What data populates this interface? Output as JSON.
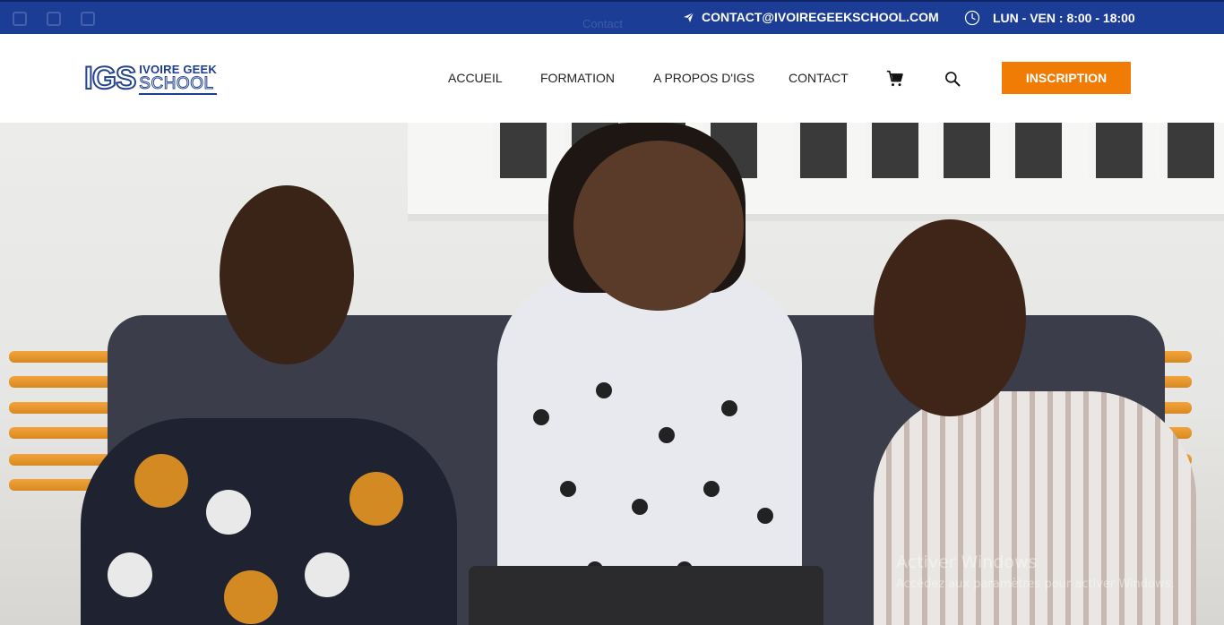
{
  "topbar": {
    "email": "CONTACT@IVOIREGEEKSCHOOL.COM",
    "hours": "LUN - VEN : 8:00 - 18:00",
    "ghost_text": "Contact",
    "icons": [
      "paper-plane-icon",
      "clock-icon"
    ],
    "background": "#1c3d96"
  },
  "header": {
    "logo": {
      "mark": "IGS",
      "line1": "IVOIRE GEEK",
      "line2": "SCHOOL"
    },
    "nav": [
      {
        "label": "ACCUEIL"
      },
      {
        "label": "FORMATION"
      },
      {
        "label": "A PROPOS D'IGS"
      },
      {
        "label": "CONTACT"
      }
    ],
    "cart_icon": "cart-icon",
    "search_icon": "search-icon",
    "cta": {
      "label": "INSCRIPTION",
      "color": "#f07b05"
    }
  },
  "hero": {
    "watermark_title": "Activer Windows",
    "watermark_subtitle": "Accédez aux paramètres pour activer Windows."
  }
}
